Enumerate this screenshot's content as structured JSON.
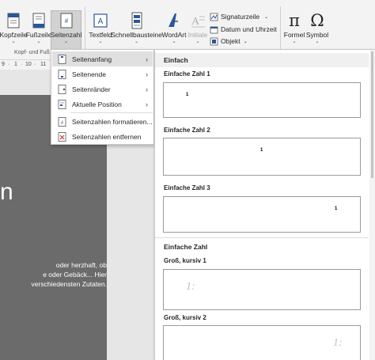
{
  "ribbon": {
    "header_footer": {
      "header_label": "Kopfzeile",
      "footer_label": "Fußzeile",
      "page_number_label": "Seitenzahl",
      "group_label": "Kopf- und Fuß"
    },
    "text": {
      "textbox_label": "Textfeld",
      "quickparts_label": "Schnellbausteine",
      "wordart_label": "WordArt",
      "dropcap_label": "Initiale",
      "signature_label": "Signaturzeile",
      "datetime_label": "Datum und Uhrzeit",
      "object_label": "Objekt"
    },
    "symbols": {
      "formula_label": "Formel",
      "symbol_label": "Symbol",
      "pi_glyph": "π",
      "omega_glyph": "Ω"
    }
  },
  "ruler": {
    "ticks": [
      "9",
      "·",
      "1",
      "·",
      "10",
      "·",
      "11"
    ]
  },
  "document": {
    "big_text": "n",
    "lines": [
      "oder herzhaft, ob",
      "e oder Gebäck... Hier",
      "verschiedensten Zutaten."
    ]
  },
  "context_menu": {
    "items": [
      {
        "label": "Seitenanfang",
        "icon": "page-top-icon"
      },
      {
        "label": "Seitenende",
        "icon": "page-bottom-icon"
      },
      {
        "label": "Seitenränder",
        "icon": "page-margins-icon"
      },
      {
        "label": "Aktuelle Position",
        "icon": "current-position-icon"
      },
      {
        "label": "Seitenzahlen formatieren...",
        "icon": "format-numbers-icon"
      },
      {
        "label": "Seitenzahlen entfernen",
        "icon": "remove-numbers-icon"
      }
    ],
    "submenu_arrow": "›"
  },
  "gallery": {
    "section_simple": "Einfach",
    "simple_1": "Einfache Zahl 1",
    "simple_2": "Einfache Zahl 2",
    "simple_3": "Einfache Zahl 3",
    "section_plain": "Einfache Zahl",
    "large_1": "Groß, kursiv 1",
    "large_2": "Groß, kursiv 2",
    "num_small": "1",
    "num_big": "1:"
  },
  "colors": {
    "ribbon_bg": "#f3f3f3",
    "doc_page": "#6b6b6b",
    "accent_blue": "#2b579a",
    "highlight": "#e0e0e0"
  }
}
